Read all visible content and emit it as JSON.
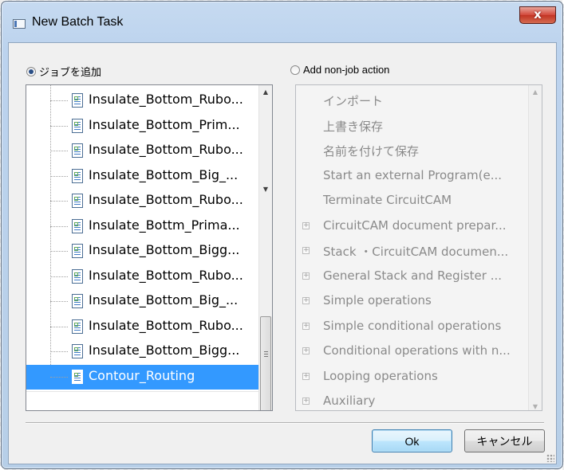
{
  "window": {
    "title": "New Batch Task",
    "close_label": "x"
  },
  "options": {
    "add_job_label": "ジョブを追加",
    "add_job_selected": true,
    "add_nonjob_label": "Add non-job action",
    "add_nonjob_selected": false
  },
  "jobs": {
    "items": [
      {
        "label": "Insulate_Bottom_Rubo...",
        "selected": false
      },
      {
        "label": "Insulate_Bottom_Prim...",
        "selected": false
      },
      {
        "label": "Insulate_Bottom_Rubo...",
        "selected": false
      },
      {
        "label": "Insulate_Bottom_Big_...",
        "selected": false
      },
      {
        "label": "Insulate_Bottom_Rubo...",
        "selected": false
      },
      {
        "label": "Insulate_Bottm_Prima...",
        "selected": false
      },
      {
        "label": "Insulate_Bottom_Bigg...",
        "selected": false
      },
      {
        "label": "Insulate_Bottom_Rubo...",
        "selected": false
      },
      {
        "label": "Insulate_Bottom_Big_...",
        "selected": false
      },
      {
        "label": "Insulate_Bottom_Rubo...",
        "selected": false
      },
      {
        "label": "Insulate_Bottom_Bigg...",
        "selected": false
      },
      {
        "label": "Contour_Routing",
        "selected": true
      }
    ]
  },
  "actions": {
    "items": [
      {
        "label": "インポート",
        "expandable": false
      },
      {
        "label": "上書き保存",
        "expandable": false
      },
      {
        "label": "名前を付けて保存",
        "expandable": false
      },
      {
        "label": "Start an external Program(e...",
        "expandable": false
      },
      {
        "label": "Terminate CircuitCAM",
        "expandable": false
      },
      {
        "label": "CircuitCAM document prepar...",
        "expandable": true
      },
      {
        "label": "Stack ・CircuitCAM documen...",
        "expandable": true
      },
      {
        "label": "General Stack and Register ...",
        "expandable": true
      },
      {
        "label": "Simple operations",
        "expandable": true
      },
      {
        "label": "Simple conditional operations",
        "expandable": true
      },
      {
        "label": "Conditional operations with n...",
        "expandable": true
      },
      {
        "label": "Looping operations",
        "expandable": true
      },
      {
        "label": "Auxiliary",
        "expandable": true
      }
    ]
  },
  "buttons": {
    "ok_label": "Ok",
    "cancel_label": "キャンセル"
  },
  "colors": {
    "selection": "#3399ff",
    "titlebar": "#c6daf0",
    "close_button": "#c23424"
  }
}
